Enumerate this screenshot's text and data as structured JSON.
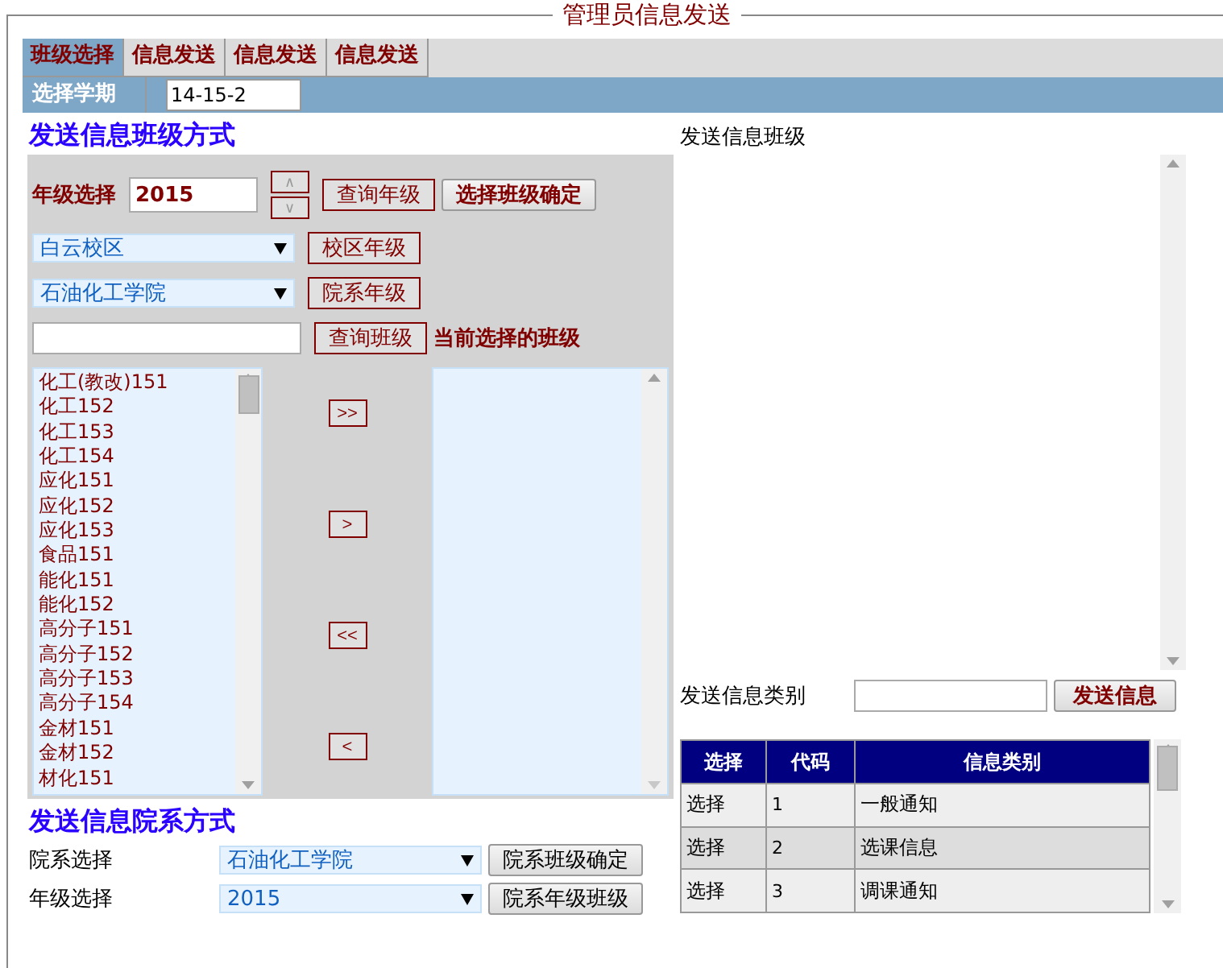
{
  "legend": "管理员信息发送",
  "tabs": [
    {
      "label": "班级选择",
      "selected": true
    },
    {
      "label": "信息发送",
      "selected": false
    },
    {
      "label": "信息发送",
      "selected": false
    },
    {
      "label": "信息发送",
      "selected": false
    }
  ],
  "term": {
    "label": "选择学期",
    "value": "14-15-2"
  },
  "class_mode": {
    "heading": "发送信息班级方式",
    "grade_label": "年级选择",
    "grade_value": "2015",
    "spin_up": "∧",
    "spin_down": "∨",
    "grade_buttons": [
      {
        "label": "查询年级",
        "kind": "outlined"
      },
      {
        "label": "选择班级确定",
        "kind": "raised"
      }
    ],
    "campus": {
      "value": "白云校区",
      "button": "校区年级"
    },
    "college": {
      "value": "石油化工学院",
      "button": "院系年级"
    },
    "search_button": "查询班级",
    "selected_label": "当前选择的班级",
    "classes": [
      "化工(教改)151",
      "化工152",
      "化工153",
      "化工154",
      "应化151",
      "应化152",
      "应化153",
      "食品151",
      "能化151",
      "能化152",
      "高分子151",
      "高分子152",
      "高分子153",
      "高分子154",
      "金材151",
      "金材152",
      "材化151"
    ],
    "move_buttons": [
      ">>",
      ">",
      "<<",
      "<"
    ]
  },
  "dept_mode": {
    "heading": "发送信息院系方式",
    "rows": [
      {
        "label": "院系选择",
        "value": "石油化工学院",
        "button": "院系班级确定"
      },
      {
        "label": "年级选择",
        "value": "2015",
        "button": "院系年级班级"
      }
    ]
  },
  "recipients_label": "发送信息班级",
  "category_label": "发送信息类别",
  "send_button": "发送信息",
  "table": {
    "columns": [
      "选择",
      "代码",
      "信息类别"
    ],
    "rows": [
      [
        "选择",
        "1",
        "一般通知"
      ],
      [
        "选择",
        "2",
        "选课信息"
      ],
      [
        "选择",
        "3",
        "调课通知"
      ]
    ]
  }
}
